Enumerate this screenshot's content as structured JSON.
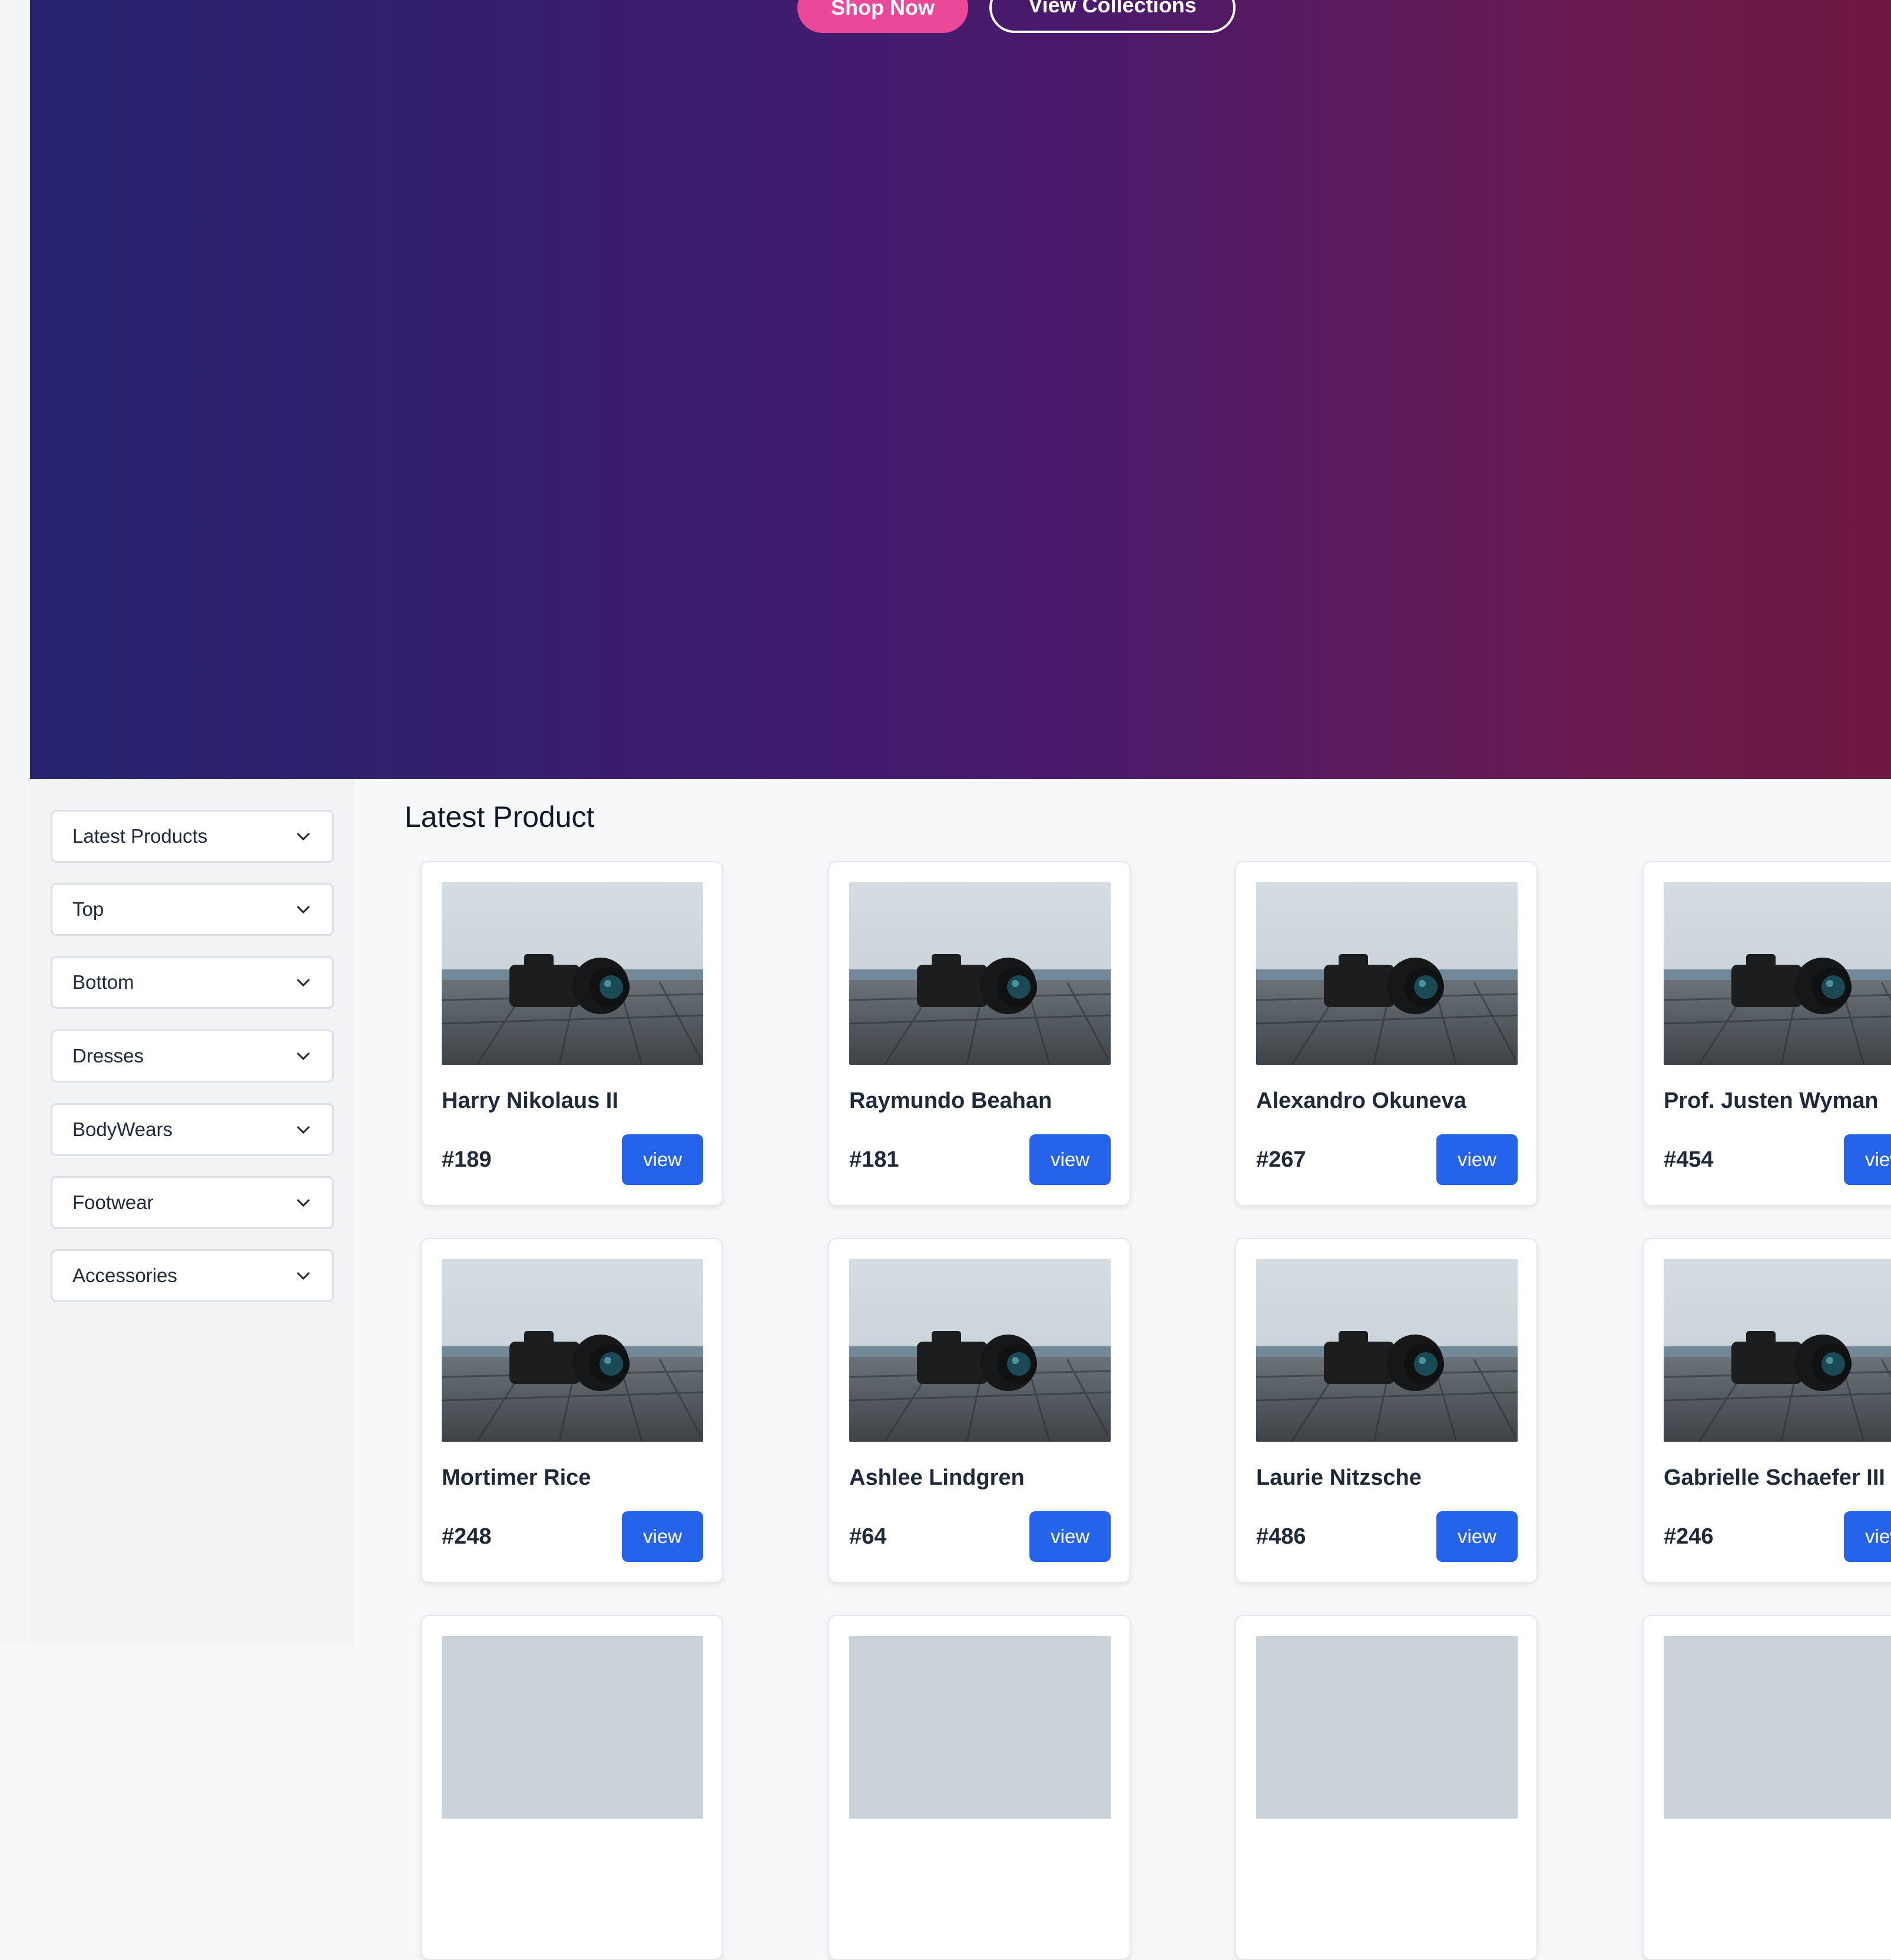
{
  "hero": {
    "shop_label": "Shop Now",
    "collections_label": "View Collections"
  },
  "sidebar": {
    "categories": [
      {
        "label": "Latest Products"
      },
      {
        "label": "Top"
      },
      {
        "label": "Bottom"
      },
      {
        "label": "Dresses"
      },
      {
        "label": "BodyWears"
      },
      {
        "label": "Footwear"
      },
      {
        "label": "Accessories"
      }
    ]
  },
  "main": {
    "title": "Latest Product",
    "view_label": "view",
    "products": [
      {
        "name": "Harry Nikolaus II",
        "id": "#189"
      },
      {
        "name": "Raymundo Beahan",
        "id": "#181"
      },
      {
        "name": "Alexandro Okuneva",
        "id": "#267"
      },
      {
        "name": "Prof. Justen Wyman",
        "id": "#454"
      },
      {
        "name": "Mortimer Rice",
        "id": "#248"
      },
      {
        "name": "Ashlee Lindgren",
        "id": "#64"
      },
      {
        "name": "Laurie Nitzsche",
        "id": "#486"
      },
      {
        "name": "Gabrielle Schaefer III",
        "id": "#246"
      }
    ]
  },
  "colors": {
    "accent_pink": "#ec4899",
    "primary_blue": "#2563eb",
    "hero_left": "#262470",
    "hero_right": "#6e1740"
  }
}
